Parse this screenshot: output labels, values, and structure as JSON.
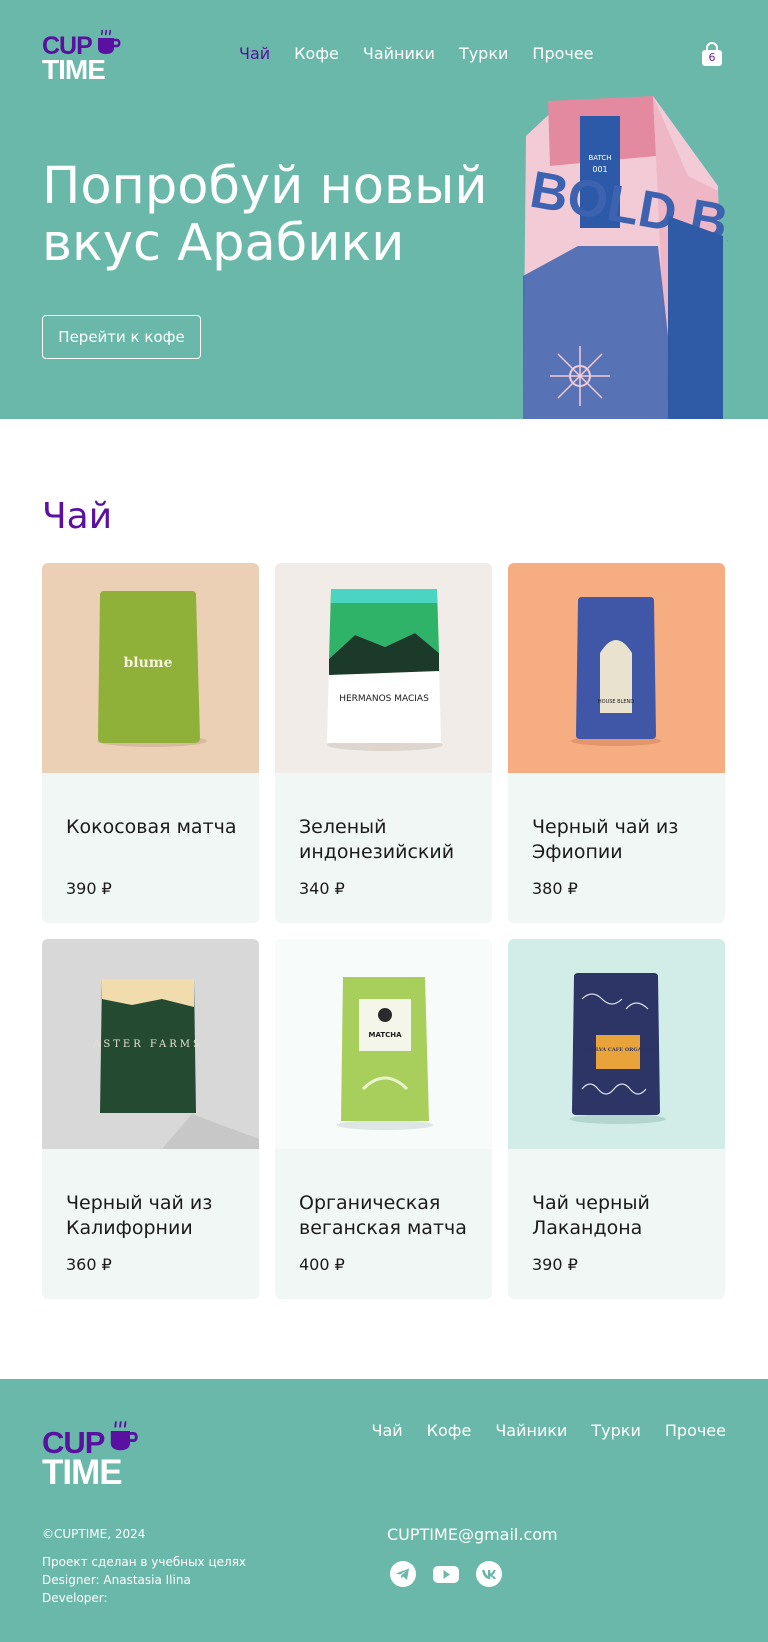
{
  "brand": {
    "line1": "CUP",
    "line2": "TIME"
  },
  "nav": {
    "items": [
      {
        "label": "Чай",
        "active": true
      },
      {
        "label": "Кофе"
      },
      {
        "label": "Чайники"
      },
      {
        "label": "Турки"
      },
      {
        "label": "Прочее"
      }
    ]
  },
  "cart": {
    "count": "6",
    "icon": "shopping-bag-icon"
  },
  "hero": {
    "title": "Попробуй новый вкус Арабики",
    "button_label": "Перейти к кофе",
    "package_text": "BOLD BREW COFFEE"
  },
  "catalog": {
    "title": "Чай",
    "products": [
      {
        "name": "Кокосовая матча",
        "price": "390 ₽",
        "image_bg": "#ecd0b5",
        "pack_color": "#8fb13a",
        "pack_label": "blume"
      },
      {
        "name": "Зеленый индонезийский чай",
        "price": "340 ₽",
        "image_bg": "#f1ece8",
        "pack_color": "#ffffff",
        "pack_label": "HERMANOS MACIAS"
      },
      {
        "name": "Черный чай из Эфиопии",
        "price": "380 ₽",
        "image_bg": "#f7ad82",
        "pack_color": "#3f57a6",
        "pack_label": "HOUSE BLEND"
      },
      {
        "name": "Черный чай из Калифорнии",
        "price": "360 ₽",
        "image_bg": "#d8d8d8",
        "pack_color": "#244b32",
        "pack_label": "ASTER FARMS"
      },
      {
        "name": "Органическая веганская матча",
        "price": "400 ₽",
        "image_bg": "#f7fbfa",
        "pack_color": "#a8cf5c",
        "pack_label": "MATCHA"
      },
      {
        "name": "Чай черный Лакандона",
        "price": "390 ₽",
        "image_bg": "#d2ede8",
        "pack_color": "#2c3566",
        "pack_label": "LA SELVA CAFE ORGANICO"
      }
    ]
  },
  "footer": {
    "nav": [
      "Чай",
      "Кофе",
      "Чайники",
      "Турки",
      "Прочее"
    ],
    "copyright": "©CUPTIME, 2024",
    "credits": [
      "Проект сделан в учебных целях",
      "Designer: Anastasia Ilina",
      "Developer:"
    ],
    "email": "CUPTIME@gmail.com",
    "socials": [
      "telegram-icon",
      "youtube-icon",
      "vk-icon"
    ]
  },
  "colors": {
    "teal": "#6ab8a9",
    "purple": "#5a10a0",
    "card_bg": "#f1f7f5"
  }
}
